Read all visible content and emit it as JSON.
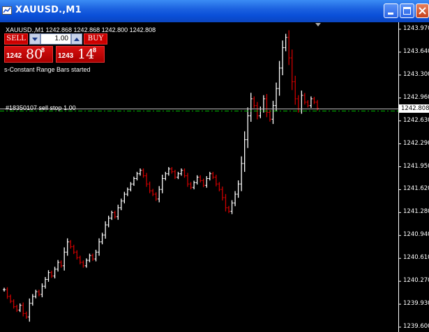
{
  "window": {
    "title": "XAUUSD.,M1"
  },
  "chart_header": {
    "symbol_line": "XAUUSD.,M1  1242.868 1242.868 1242.800 1242.808"
  },
  "trade_panel": {
    "sell_label": "SELL",
    "buy_label": "BUY",
    "lot_value": "1.00",
    "sell_price_prefix": "1242",
    "sell_price_main": "80",
    "sell_price_sup": "8",
    "buy_price_prefix": "1243",
    "buy_price_main": "14",
    "buy_price_sup": "8"
  },
  "status_text": "s-Constant Range Bars started",
  "order_label": "#18350107 sell stop 1.00",
  "price_axis": {
    "current_price": "1242.808",
    "ticks": [
      "1243.970",
      "1243.640",
      "1243.300",
      "1242.960",
      "1242.630",
      "1242.290",
      "1241.950",
      "1241.620",
      "1241.280",
      "1240.940",
      "1240.610",
      "1240.270",
      "1239.930",
      "1239.600"
    ]
  },
  "colors": {
    "titlebar": "#0a4fd8",
    "background": "#000000",
    "bull_bar": "#ffffff",
    "bear_bar": "#cc0000",
    "order_line": "#00c000"
  },
  "chart_data": {
    "type": "bar",
    "symbol": "XAUUSD.",
    "timeframe": "M1",
    "ylim": [
      1239.6,
      1243.97
    ],
    "price_ticks": [
      1243.97,
      1243.64,
      1243.3,
      1242.96,
      1242.63,
      1242.29,
      1241.95,
      1241.62,
      1241.28,
      1240.94,
      1240.61,
      1240.27,
      1239.93,
      1239.6
    ],
    "close_series": [
      1240.15,
      1240.05,
      1239.98,
      1239.9,
      1239.85,
      1239.92,
      1239.8,
      1239.75,
      1239.95,
      1240.05,
      1240.12,
      1240.08,
      1240.2,
      1240.3,
      1240.4,
      1240.35,
      1240.45,
      1240.55,
      1240.5,
      1240.7,
      1240.85,
      1240.78,
      1240.7,
      1240.62,
      1240.55,
      1240.5,
      1240.58,
      1240.65,
      1240.6,
      1240.7,
      1240.85,
      1240.95,
      1241.1,
      1241.2,
      1241.28,
      1241.22,
      1241.35,
      1241.45,
      1241.55,
      1241.62,
      1241.7,
      1241.78,
      1241.85,
      1241.9,
      1241.82,
      1241.7,
      1241.6,
      1241.55,
      1241.48,
      1241.62,
      1241.78,
      1241.85,
      1241.92,
      1241.88,
      1241.8,
      1241.85,
      1241.9,
      1241.82,
      1241.7,
      1241.65,
      1241.72,
      1241.8,
      1241.75,
      1241.68,
      1241.78,
      1241.85,
      1241.8,
      1241.7,
      1241.62,
      1241.5,
      1241.35,
      1241.3,
      1241.42,
      1241.55,
      1241.7,
      1242.0,
      1242.35,
      1242.7,
      1242.95,
      1242.85,
      1242.7,
      1242.8,
      1242.95,
      1242.75,
      1242.65,
      1242.85,
      1243.1,
      1243.4,
      1243.7,
      1243.85,
      1243.55,
      1243.2,
      1242.95,
      1242.8,
      1243.0,
      1242.9,
      1242.85,
      1242.95,
      1242.9,
      1242.81
    ],
    "order_line_price": 1242.78,
    "order_line_label": "#18350107 sell stop 1.00",
    "bid_line_price": 1242.808
  }
}
